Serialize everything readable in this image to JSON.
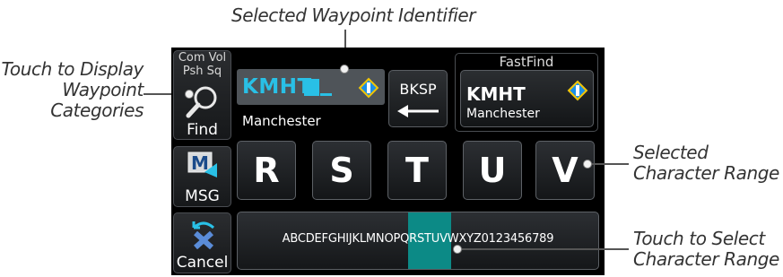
{
  "callouts": {
    "top": "Selected Waypoint Identifier",
    "left_lines": [
      "Touch to Display",
      "Waypoint",
      "Categories"
    ],
    "right_top_lines": [
      "Selected",
      "Character Range"
    ],
    "right_bottom_lines": [
      "Touch to Select",
      "Character Range"
    ]
  },
  "sidebar": {
    "com_vol_label": "Com Vol",
    "psh_sq_label": "Psh Sq",
    "find_label": "Find",
    "msg_label": "MSG",
    "cancel_label": "Cancel"
  },
  "waypoint": {
    "identifier": "KMHT",
    "name": "Manchester"
  },
  "backspace_label": "BKSP",
  "fastfind": {
    "title": "FastFind",
    "identifier": "KMHT",
    "name": "Manchester"
  },
  "character_keys": [
    "R",
    "S",
    "T",
    "U",
    "V"
  ],
  "character_range": {
    "all_characters": "ABCDEFGHIJKLMNOPQRSTUVWXYZ0123456789",
    "selected": "RSTUV"
  },
  "colors": {
    "accent_cyan": "#29c0e6",
    "range_highlight": "#0c8a86",
    "screen_bg": "#000000",
    "waypoint_symbol_fill": "#1b8fe8",
    "waypoint_symbol_border": "#f5c400"
  },
  "icons": {
    "find": "magnifier-icon",
    "msg": "message-icon",
    "cancel": "cancel-icon",
    "backspace": "left-arrow-icon",
    "waypoint": "airport-icon"
  }
}
